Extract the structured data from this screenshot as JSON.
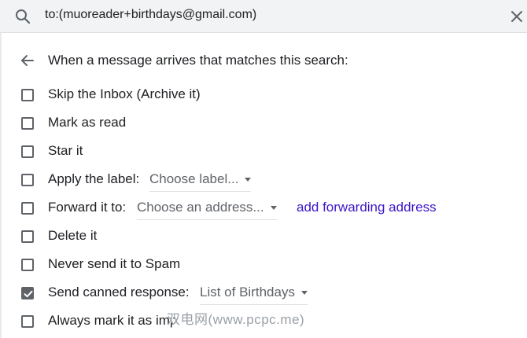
{
  "search": {
    "query": "to:(muoreader+birthdays@gmail.com)",
    "search_icon": "search-icon",
    "close_icon": "close-icon"
  },
  "header": {
    "back_icon": "arrow-back-icon",
    "text": "When a message arrives that matches this search:"
  },
  "options": [
    {
      "label": "Skip the Inbox (Archive it)",
      "checked": false
    },
    {
      "label": "Mark as read",
      "checked": false
    },
    {
      "label": "Star it",
      "checked": false
    },
    {
      "label": "Apply the label:",
      "checked": false,
      "dropdown": "Choose label..."
    },
    {
      "label": "Forward it to:",
      "checked": false,
      "dropdown": "Choose an address...",
      "link": "add forwarding address"
    },
    {
      "label": "Delete it",
      "checked": false
    },
    {
      "label": "Never send it to Spam",
      "checked": false
    },
    {
      "label": "Send canned response:",
      "checked": true,
      "dropdown": "List of Birthdays"
    },
    {
      "label": "Always mark it as imp",
      "checked": false
    }
  ],
  "watermark": "双电网(www.pcpc.me)",
  "colors": {
    "search_bg": "#f1f3f4",
    "text": "#202124",
    "secondary": "#5f6368",
    "link": "#3c16c7"
  }
}
